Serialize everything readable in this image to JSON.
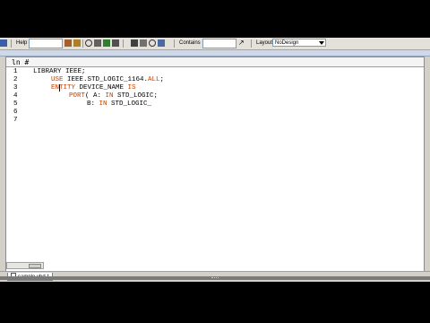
{
  "toolbar": {
    "help_label": "Help",
    "contains_label": "Contains",
    "layout_label": "Layout",
    "layout_value": "NoDesign"
  },
  "editor": {
    "column_header": "ln #",
    "line_numbers": [
      "1",
      "2",
      "3",
      "4",
      "5",
      "6",
      "7"
    ],
    "lines": [
      {
        "pre": "LIBRARY IEEE;",
        "kw": "",
        "post": ""
      },
      {
        "pre": "",
        "kw": "USE",
        "post": " IEEE.STD_LOGIC_1164."
      },
      {
        "pre": "",
        "kw": "ENTITY",
        "post": " DEVICE_NAME "
      },
      {
        "pre": "",
        "kw": "PORT",
        "post": "( A: "
      },
      {
        "pre": "B: ",
        "kw": "IN",
        "post": " STD_LOGIC_"
      }
    ],
    "line2_tail_keyword": "ALL",
    "line2_end": ";",
    "line3_tail_keyword": "IS",
    "line4_in_keyword": "IN",
    "line4_end": " STD_LOGIC;"
  },
  "tabs": [
    {
      "label": "sample.vhd *"
    }
  ],
  "colors": {
    "keyword": "#c04000",
    "editor_bg": "#ffffff",
    "chrome": "#d4d0c8"
  }
}
